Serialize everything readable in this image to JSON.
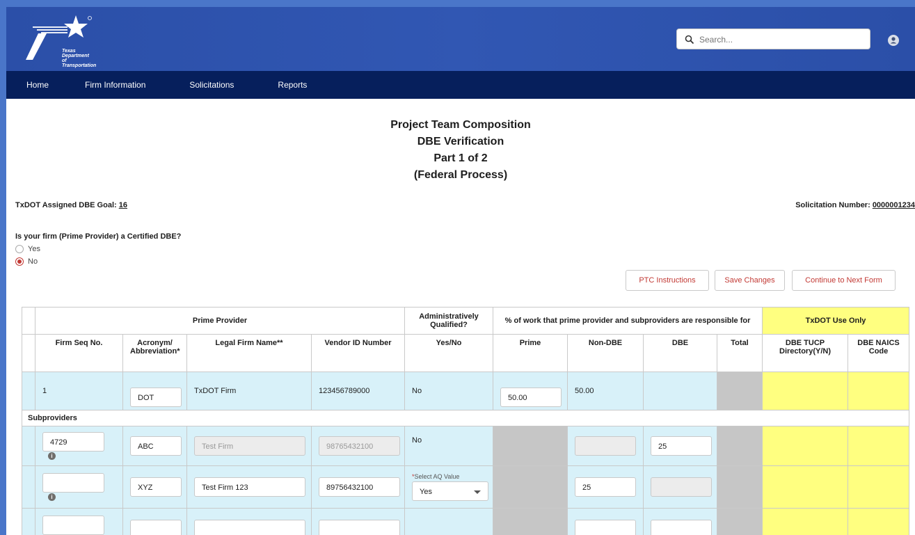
{
  "header": {
    "logo_lines": [
      "Texas",
      "Department",
      "of Transportation"
    ],
    "search_placeholder": "Search...",
    "icons": {
      "search": "search-icon",
      "user": "user-avatar-icon"
    }
  },
  "nav": {
    "items": [
      "Home",
      "Firm Information",
      "Solicitations",
      "Reports"
    ]
  },
  "titles": [
    "Project Team Composition",
    "DBE Verification",
    "Part 1 of 2",
    "(Federal Process)"
  ],
  "goal": {
    "label": "TxDOT Assigned DBE Goal:",
    "value": "16"
  },
  "solicitation": {
    "label": "Solicitation Number:",
    "value": "0000001234"
  },
  "question": {
    "label": "Is your firm (Prime Provider) a Certified DBE?",
    "options": [
      "Yes",
      "No"
    ],
    "selected": "No"
  },
  "buttons": {
    "instructions": "PTC Instructions",
    "save": "Save Changes",
    "continue": "Continue to Next Form"
  },
  "table": {
    "group_headers": {
      "prime_provider": "Prime Provider",
      "admin_qualified": "Administratively Qualified?",
      "percent_work": "% of work that prime provider and subproviders are responsible for",
      "txdot_only": "TxDOT Use Only"
    },
    "columns": {
      "seq": "Firm Seq No.",
      "acronym": "Acronym/ Abbreviation*",
      "legal_name": "Legal Firm Name**",
      "vendor_id": "Vendor ID Number",
      "yes_no": "Yes/No",
      "prime": "Prime",
      "non_dbe": "Non-DBE",
      "dbe": "DBE",
      "total": "Total",
      "tucp": "DBE TUCP Directory(Y/N)",
      "naics": "DBE NAICS Code"
    },
    "prime_row": {
      "seq": "1",
      "acronym": "DOT",
      "legal_name": "TxDOT Firm",
      "vendor_id": "123456789000",
      "aq": "No",
      "prime": "50.00",
      "non_dbe": "50.00"
    },
    "subproviders_label": "Subproviders",
    "sub_rows": [
      {
        "seq": "4729",
        "acronym": "ABC",
        "legal_name": "Test Firm",
        "vendor_id": "98765432100",
        "aq": "No",
        "non_dbe": "",
        "dbe": "25"
      },
      {
        "seq": "",
        "acronym": "XYZ",
        "legal_name": "Test Firm 123",
        "vendor_id": "89756432100",
        "aq_label": "Select AQ Value",
        "aq_select": "Yes",
        "non_dbe": "25",
        "dbe": ""
      },
      {
        "seq": "",
        "acronym": "",
        "legal_name": "",
        "vendor_id": "",
        "non_dbe": "",
        "dbe": ""
      }
    ]
  }
}
